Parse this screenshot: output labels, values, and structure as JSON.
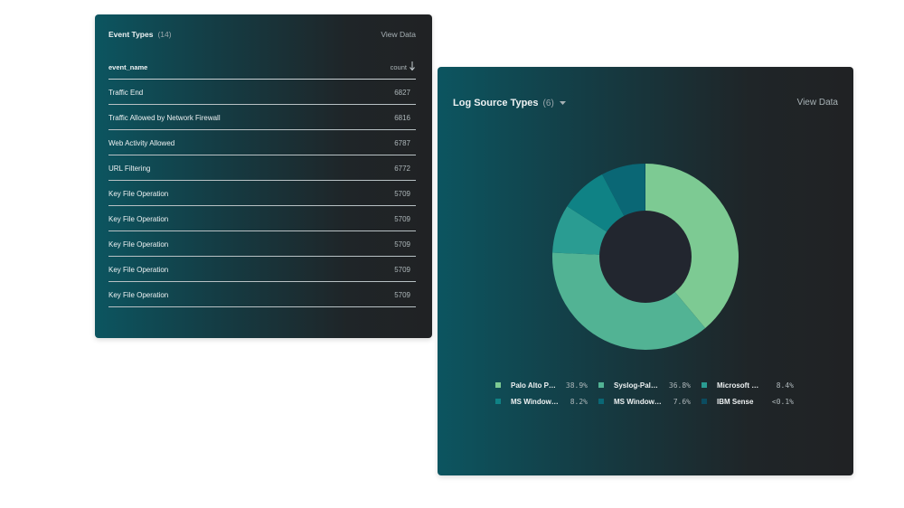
{
  "event_types": {
    "title": "Event Types",
    "count": "(14)",
    "view_data": "View Data",
    "columns": {
      "name": "event_name",
      "count": "count"
    },
    "rows": [
      {
        "name": "Traffic End",
        "count": "6827"
      },
      {
        "name": "Traffic Allowed by Network Firewall",
        "count": "6816"
      },
      {
        "name": "Web Activity Allowed",
        "count": "6787"
      },
      {
        "name": "URL Filtering",
        "count": "6772"
      },
      {
        "name": "Key File Operation",
        "count": "5709"
      },
      {
        "name": "Key File Operation",
        "count": "5709"
      },
      {
        "name": "Key File Operation",
        "count": "5709"
      },
      {
        "name": "Key File Operation",
        "count": "5709"
      },
      {
        "name": "Key File Operation",
        "count": "5709"
      }
    ],
    "sort_icon": "arrow-down-icon"
  },
  "log_source_types": {
    "title": "Log Source Types",
    "count": "(6)",
    "view_data": "View Data",
    "dropdown_icon": "caret-down-icon"
  },
  "chart_data": {
    "type": "pie",
    "donut": true,
    "slices": [
      {
        "label": "Palo Alto P…",
        "pct_label": "38.9%",
        "value": 38.9,
        "color": "#7dca93"
      },
      {
        "label": "Syslog-Pal…",
        "pct_label": "36.8%",
        "value": 36.8,
        "color": "#52b394"
      },
      {
        "label": "Microsoft …",
        "pct_label": "8.4%",
        "value": 8.4,
        "color": "#2a9c92"
      },
      {
        "label": "MS Window…",
        "pct_label": "8.2%",
        "value": 8.2,
        "color": "#0f8285"
      },
      {
        "label": "MS Window…",
        "pct_label": "7.6%",
        "value": 7.6,
        "color": "#0a6775"
      },
      {
        "label": "IBM Sense",
        "pct_label": "<0.1%",
        "value": 0.1,
        "color": "#0b4c60"
      }
    ],
    "legend_position": "bottom",
    "hole_color": "#22262f"
  }
}
